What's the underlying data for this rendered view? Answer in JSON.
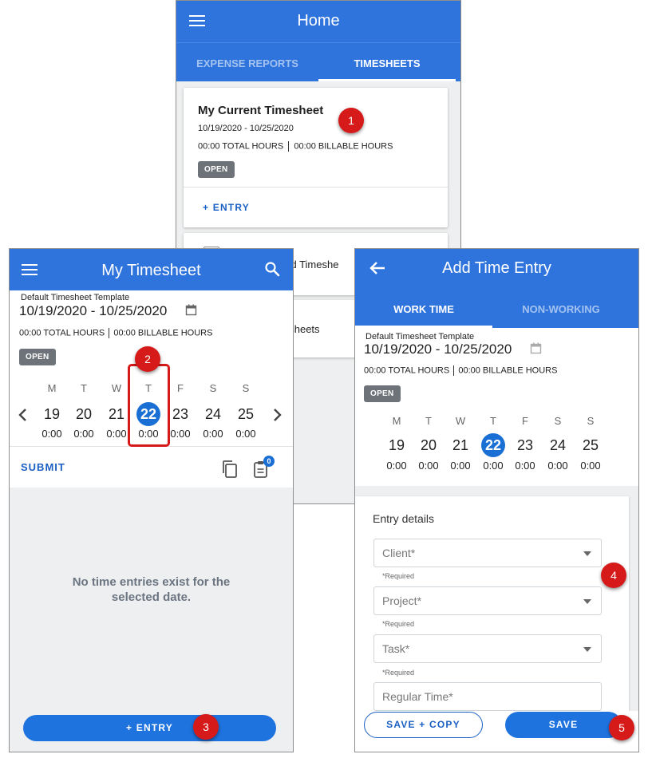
{
  "home": {
    "title": "Home",
    "tabs": [
      "EXPENSE REPORTS",
      "TIMESHEETS"
    ],
    "card_title": "My Current Timesheet",
    "date_range": "10/19/2020 - 10/25/2020",
    "total_hours": "00:00 TOTAL HOURS",
    "billable_hours": "00:00 BILLABLE HOURS",
    "status": "OPEN",
    "entry_button": "+ ENTRY",
    "card2_partial": "ned Timeshe",
    "card3_partial": "esheets"
  },
  "my_timesheet": {
    "title": "My Timesheet",
    "template": "Default Timesheet Template",
    "date_range": "10/19/2020 - 10/25/2020",
    "total_hours": "00:00 TOTAL HOURS",
    "billable_hours": "00:00 BILLABLE HOURS",
    "status": "OPEN",
    "days": [
      {
        "letter": "M",
        "num": "19",
        "hours": "0:00"
      },
      {
        "letter": "T",
        "num": "20",
        "hours": "0:00"
      },
      {
        "letter": "W",
        "num": "21",
        "hours": "0:00"
      },
      {
        "letter": "T",
        "num": "22",
        "hours": "0:00"
      },
      {
        "letter": "F",
        "num": "23",
        "hours": "0:00"
      },
      {
        "letter": "S",
        "num": "24",
        "hours": "0:00"
      },
      {
        "letter": "S",
        "num": "25",
        "hours": "0:00"
      }
    ],
    "submit": "SUBMIT",
    "notes_count": "0",
    "empty_message": "No time entries exist for the selected date.",
    "entry_button": "+ ENTRY"
  },
  "add_entry": {
    "title": "Add Time Entry",
    "tabs": [
      "WORK TIME",
      "NON-WORKING"
    ],
    "template": "Default Timesheet Template",
    "date_range": "10/19/2020 - 10/25/2020",
    "total_hours": "00:00 TOTAL HOURS",
    "billable_hours": "00:00 BILLABLE HOURS",
    "status": "OPEN",
    "days": [
      {
        "letter": "M",
        "num": "19",
        "hours": "0:00"
      },
      {
        "letter": "T",
        "num": "20",
        "hours": "0:00"
      },
      {
        "letter": "W",
        "num": "21",
        "hours": "0:00"
      },
      {
        "letter": "T",
        "num": "22",
        "hours": "0:00"
      },
      {
        "letter": "F",
        "num": "23",
        "hours": "0:00"
      },
      {
        "letter": "S",
        "num": "24",
        "hours": "0:00"
      },
      {
        "letter": "S",
        "num": "25",
        "hours": "0:00"
      }
    ],
    "section_title": "Entry details",
    "fields": {
      "client": "Client*",
      "project": "Project*",
      "task": "Task*",
      "regular_time": "Regular Time*",
      "required": "*Required"
    },
    "save_copy": "SAVE + COPY",
    "save": "SAVE"
  },
  "markers": [
    "1",
    "2",
    "3",
    "4",
    "5"
  ],
  "colors": {
    "primary": "#2f74dd",
    "selected": "#1a6fd4",
    "marker": "#d61a1a"
  }
}
